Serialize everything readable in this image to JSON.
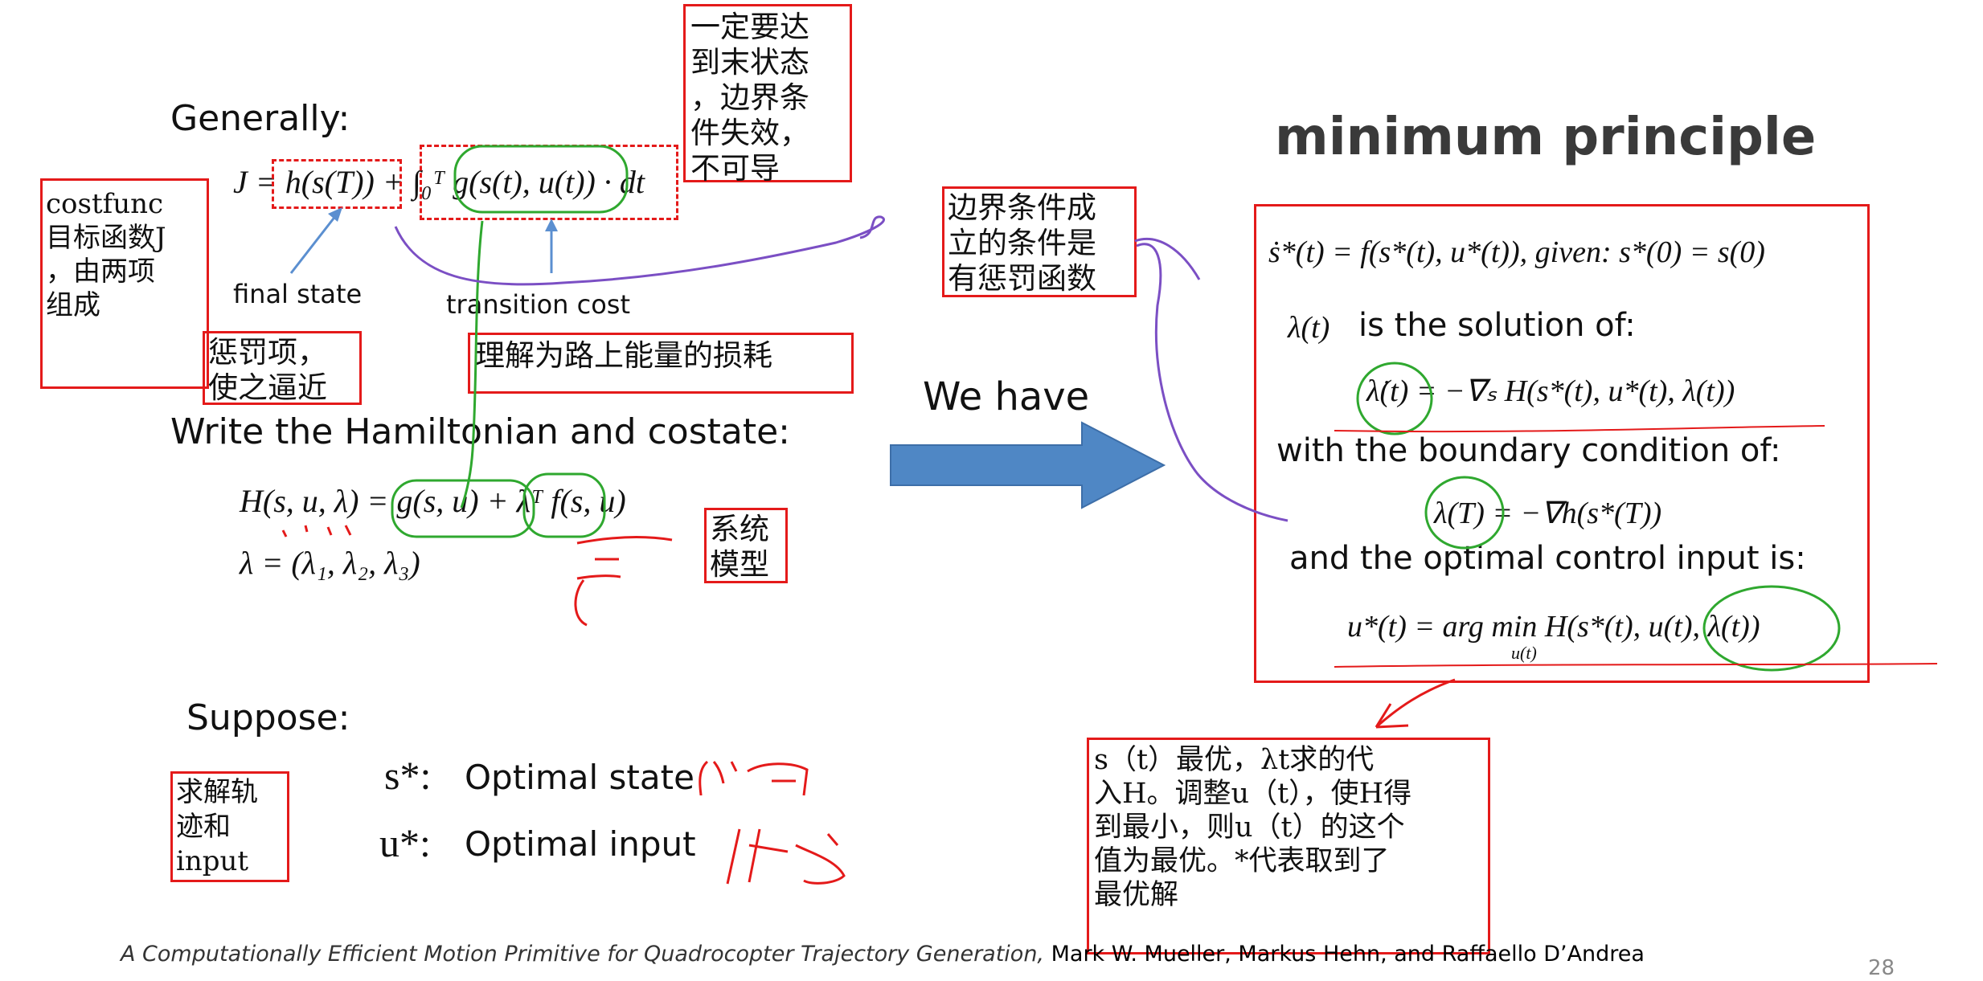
{
  "left": {
    "generally": "Generally:",
    "cost_eq": "J = h(s(T)) + ∫₀ᵀ g(s(t), u(t)) · dt",
    "label_final_state": "final state",
    "label_transition_cost": "transition cost",
    "hamiltonian_heading": "Write the Hamiltonian and costate:",
    "hamiltonian_eq": "H(s, u, λ) = g(s, u) + λᵀ f(s, u)",
    "costate_eq": "λ = (λ₁, λ₂, λ₃)",
    "suppose": "Suppose:",
    "s_star": "s*:",
    "s_star_desc": "Optimal state",
    "u_star": "u*:",
    "u_star_desc": "Optimal input"
  },
  "notes": {
    "boundary_fail": "一定要达\n到末状态\n，边界条\n件失效，\n不可导",
    "costfunc": "costfunc\n目标函数J\n，由两项\n组成",
    "penalty": "惩罚项，\n使之逼近",
    "energy": "理解为路上能量的损耗",
    "boundary_valid": "边界条件成\n立的条件是\n有惩罚函数",
    "system_model": "系统\n模型",
    "solve_traj": "求解轨\n迹和\ninput",
    "optimal_explain": "s（t）最优，λt求的代\n入H。调整u（t），使H得\n到最小，则u（t）的这个\n值为最优。*代表取到了\n最优解"
  },
  "middle": {
    "we_have": "We have"
  },
  "right": {
    "title": "minimum principle",
    "state_eq": "ṡ*(t) = f(s*(t), u*(t)),   given: s*(0) = s(0)",
    "lambda_intro": "λ(t)",
    "lambda_intro_text": "is the solution of:",
    "costate_dyn": "λ̇(t) = −∇ₛ H(s*(t), u*(t), λ(t))",
    "boundary_text": "with the boundary condition of:",
    "boundary_eq": "λ(T) = −∇h(s*(T))",
    "optimal_text": "and the optimal control input is:",
    "control_eq": "u*(t) = arg min H(s*(t), u(t), λ(t))",
    "control_sub": "u(t)"
  },
  "footer": {
    "citation_italic": "A Computationally Efficient Motion Primitive for Quadrocopter Trajectory Generation,",
    "citation_authors": " Mark W. Mueller, Markus Hehn, and Raffaello D’Andrea",
    "page_number": "28"
  },
  "colors": {
    "annotation_red": "#e41a1a",
    "annotation_green": "#2fa82f",
    "annotation_purple": "#7b4fc4",
    "arrow_blue": "#4f87c5",
    "thin_arrow": "#5b8fd0"
  }
}
